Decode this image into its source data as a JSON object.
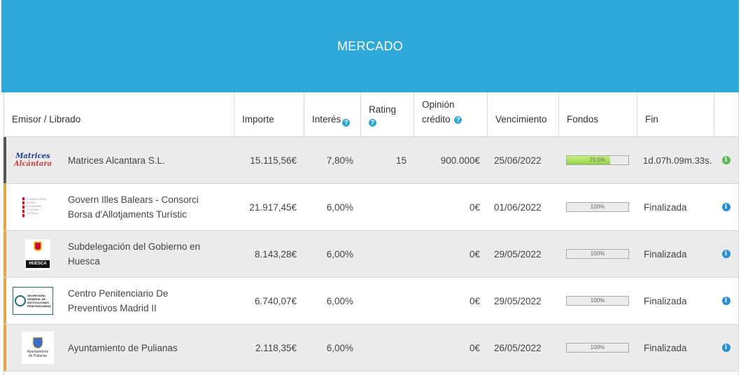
{
  "banner": {
    "title": "MERCADO"
  },
  "columns": {
    "emisor": "Emisor / Librado",
    "importe": "Importe",
    "interes": "Interés",
    "rating": "Rating",
    "opinion_l1": "Opinión",
    "opinion_l2": "crédito",
    "vencimiento": "Vencimiento",
    "fondos": "Fondos",
    "fin": "Fin"
  },
  "help_icon_glyph": "?",
  "info_icon_glyph": "i",
  "rows": [
    {
      "name": "Matrices Alcantara S.L.",
      "logo_l1": "Matrices",
      "logo_l2": "Alcántara",
      "importe": "15.115,56€",
      "interes": "7,80%",
      "rating": "15",
      "opinion": "900.000€",
      "vencimiento": "25/06/2022",
      "fondos_label": "70.5%",
      "fondos_fraction": 0.705,
      "fin": {
        "d": "1",
        "d_u": "d.",
        "h": "07",
        "h_u": "h.",
        "m": "09",
        "m_u": "m.",
        "s": "33",
        "s_u": "s."
      },
      "info_color": "#5cb85c"
    },
    {
      "name_l1": "Govern Illes Balears - Consorci",
      "name_l2": "Borsa d'Allotjaments Turístic",
      "logo_text": "CONSELLERIA MODEL ECONÒMIC, TURISME I TREBALL",
      "importe": "21.917,45€",
      "interes": "6,00%",
      "opinion": "0€",
      "vencimiento": "01/06/2022",
      "fondos_label": "100%",
      "fondos_fraction": 1.0,
      "fin": "Finalizada",
      "info_color": "#2a8fd0"
    },
    {
      "name_l1": "Subdelegación del Gobierno en",
      "name_l2": "Huesca",
      "logo_text": "HUESCA",
      "importe": "8.143,28€",
      "interes": "6,00%",
      "opinion": "0€",
      "vencimiento": "29/05/2022",
      "fondos_label": "100%",
      "fondos_fraction": 1.0,
      "fin": "Finalizada",
      "info_color": "#2a8fd0"
    },
    {
      "name_l1": "Centro Penitenciario De",
      "name_l2": "Preventivos Madrid II",
      "logo_text": "SECRETARÍA GENERAL DE INSTITUCIONES PENITENCIARIAS",
      "importe": "6.740,07€",
      "interes": "6,00%",
      "opinion": "0€",
      "vencimiento": "29/05/2022",
      "fondos_label": "100%",
      "fondos_fraction": 1.0,
      "fin": "Finalizada",
      "info_color": "#2a8fd0"
    },
    {
      "name": "Ayuntamiento de Pulianas",
      "logo_text_l1": "Ayuntamiento",
      "logo_text_l2": "de Pulianas",
      "importe": "2.118,35€",
      "interes": "6,00%",
      "opinion": "0€",
      "vencimiento": "26/05/2022",
      "fondos_label": "100%",
      "fondos_fraction": 1.0,
      "fin": "Finalizada",
      "info_color": "#2a8fd0"
    }
  ]
}
